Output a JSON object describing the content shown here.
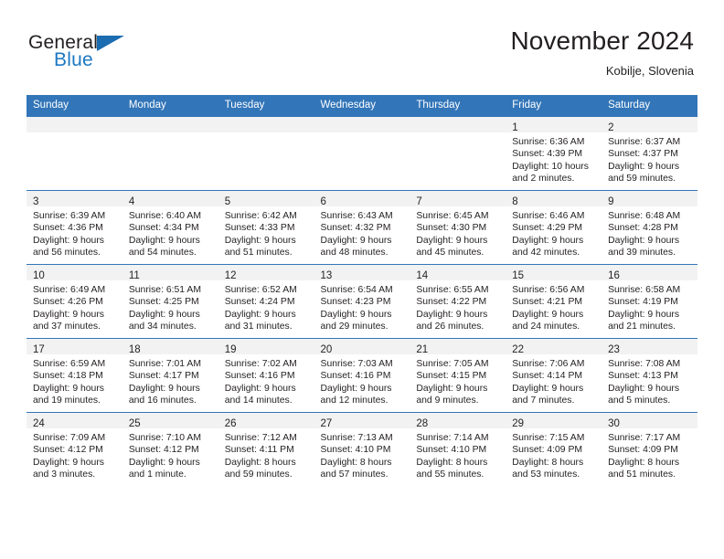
{
  "brand": {
    "name_part1": "General",
    "name_part2": "Blue",
    "flag_icon": "triangle-flag-icon"
  },
  "header": {
    "month_title": "November 2024",
    "location": "Kobilje, Slovenia"
  },
  "colors": {
    "header_blue": "#3275b8",
    "brand_blue": "#1b78c2",
    "daynum_band": "#f2f2f2",
    "text": "#231f20"
  },
  "labels": {
    "sunrise_prefix": "Sunrise:",
    "sunset_prefix": "Sunset:",
    "daylight_prefix": "Daylight:"
  },
  "weekday_headers": [
    "Sunday",
    "Monday",
    "Tuesday",
    "Wednesday",
    "Thursday",
    "Friday",
    "Saturday"
  ],
  "weeks": [
    [
      {
        "empty": true
      },
      {
        "empty": true
      },
      {
        "empty": true
      },
      {
        "empty": true
      },
      {
        "empty": true
      },
      {
        "day": "1",
        "sunrise": "Sunrise: 6:36 AM",
        "sunset": "Sunset: 4:39 PM",
        "daylight_line1": "Daylight: 10 hours",
        "daylight_line2": "and 2 minutes."
      },
      {
        "day": "2",
        "sunrise": "Sunrise: 6:37 AM",
        "sunset": "Sunset: 4:37 PM",
        "daylight_line1": "Daylight: 9 hours",
        "daylight_line2": "and 59 minutes."
      }
    ],
    [
      {
        "day": "3",
        "sunrise": "Sunrise: 6:39 AM",
        "sunset": "Sunset: 4:36 PM",
        "daylight_line1": "Daylight: 9 hours",
        "daylight_line2": "and 56 minutes."
      },
      {
        "day": "4",
        "sunrise": "Sunrise: 6:40 AM",
        "sunset": "Sunset: 4:34 PM",
        "daylight_line1": "Daylight: 9 hours",
        "daylight_line2": "and 54 minutes."
      },
      {
        "day": "5",
        "sunrise": "Sunrise: 6:42 AM",
        "sunset": "Sunset: 4:33 PM",
        "daylight_line1": "Daylight: 9 hours",
        "daylight_line2": "and 51 minutes."
      },
      {
        "day": "6",
        "sunrise": "Sunrise: 6:43 AM",
        "sunset": "Sunset: 4:32 PM",
        "daylight_line1": "Daylight: 9 hours",
        "daylight_line2": "and 48 minutes."
      },
      {
        "day": "7",
        "sunrise": "Sunrise: 6:45 AM",
        "sunset": "Sunset: 4:30 PM",
        "daylight_line1": "Daylight: 9 hours",
        "daylight_line2": "and 45 minutes."
      },
      {
        "day": "8",
        "sunrise": "Sunrise: 6:46 AM",
        "sunset": "Sunset: 4:29 PM",
        "daylight_line1": "Daylight: 9 hours",
        "daylight_line2": "and 42 minutes."
      },
      {
        "day": "9",
        "sunrise": "Sunrise: 6:48 AM",
        "sunset": "Sunset: 4:28 PM",
        "daylight_line1": "Daylight: 9 hours",
        "daylight_line2": "and 39 minutes."
      }
    ],
    [
      {
        "day": "10",
        "sunrise": "Sunrise: 6:49 AM",
        "sunset": "Sunset: 4:26 PM",
        "daylight_line1": "Daylight: 9 hours",
        "daylight_line2": "and 37 minutes."
      },
      {
        "day": "11",
        "sunrise": "Sunrise: 6:51 AM",
        "sunset": "Sunset: 4:25 PM",
        "daylight_line1": "Daylight: 9 hours",
        "daylight_line2": "and 34 minutes."
      },
      {
        "day": "12",
        "sunrise": "Sunrise: 6:52 AM",
        "sunset": "Sunset: 4:24 PM",
        "daylight_line1": "Daylight: 9 hours",
        "daylight_line2": "and 31 minutes."
      },
      {
        "day": "13",
        "sunrise": "Sunrise: 6:54 AM",
        "sunset": "Sunset: 4:23 PM",
        "daylight_line1": "Daylight: 9 hours",
        "daylight_line2": "and 29 minutes."
      },
      {
        "day": "14",
        "sunrise": "Sunrise: 6:55 AM",
        "sunset": "Sunset: 4:22 PM",
        "daylight_line1": "Daylight: 9 hours",
        "daylight_line2": "and 26 minutes."
      },
      {
        "day": "15",
        "sunrise": "Sunrise: 6:56 AM",
        "sunset": "Sunset: 4:21 PM",
        "daylight_line1": "Daylight: 9 hours",
        "daylight_line2": "and 24 minutes."
      },
      {
        "day": "16",
        "sunrise": "Sunrise: 6:58 AM",
        "sunset": "Sunset: 4:19 PM",
        "daylight_line1": "Daylight: 9 hours",
        "daylight_line2": "and 21 minutes."
      }
    ],
    [
      {
        "day": "17",
        "sunrise": "Sunrise: 6:59 AM",
        "sunset": "Sunset: 4:18 PM",
        "daylight_line1": "Daylight: 9 hours",
        "daylight_line2": "and 19 minutes."
      },
      {
        "day": "18",
        "sunrise": "Sunrise: 7:01 AM",
        "sunset": "Sunset: 4:17 PM",
        "daylight_line1": "Daylight: 9 hours",
        "daylight_line2": "and 16 minutes."
      },
      {
        "day": "19",
        "sunrise": "Sunrise: 7:02 AM",
        "sunset": "Sunset: 4:16 PM",
        "daylight_line1": "Daylight: 9 hours",
        "daylight_line2": "and 14 minutes."
      },
      {
        "day": "20",
        "sunrise": "Sunrise: 7:03 AM",
        "sunset": "Sunset: 4:16 PM",
        "daylight_line1": "Daylight: 9 hours",
        "daylight_line2": "and 12 minutes."
      },
      {
        "day": "21",
        "sunrise": "Sunrise: 7:05 AM",
        "sunset": "Sunset: 4:15 PM",
        "daylight_line1": "Daylight: 9 hours",
        "daylight_line2": "and 9 minutes."
      },
      {
        "day": "22",
        "sunrise": "Sunrise: 7:06 AM",
        "sunset": "Sunset: 4:14 PM",
        "daylight_line1": "Daylight: 9 hours",
        "daylight_line2": "and 7 minutes."
      },
      {
        "day": "23",
        "sunrise": "Sunrise: 7:08 AM",
        "sunset": "Sunset: 4:13 PM",
        "daylight_line1": "Daylight: 9 hours",
        "daylight_line2": "and 5 minutes."
      }
    ],
    [
      {
        "day": "24",
        "sunrise": "Sunrise: 7:09 AM",
        "sunset": "Sunset: 4:12 PM",
        "daylight_line1": "Daylight: 9 hours",
        "daylight_line2": "and 3 minutes."
      },
      {
        "day": "25",
        "sunrise": "Sunrise: 7:10 AM",
        "sunset": "Sunset: 4:12 PM",
        "daylight_line1": "Daylight: 9 hours",
        "daylight_line2": "and 1 minute."
      },
      {
        "day": "26",
        "sunrise": "Sunrise: 7:12 AM",
        "sunset": "Sunset: 4:11 PM",
        "daylight_line1": "Daylight: 8 hours",
        "daylight_line2": "and 59 minutes."
      },
      {
        "day": "27",
        "sunrise": "Sunrise: 7:13 AM",
        "sunset": "Sunset: 4:10 PM",
        "daylight_line1": "Daylight: 8 hours",
        "daylight_line2": "and 57 minutes."
      },
      {
        "day": "28",
        "sunrise": "Sunrise: 7:14 AM",
        "sunset": "Sunset: 4:10 PM",
        "daylight_line1": "Daylight: 8 hours",
        "daylight_line2": "and 55 minutes."
      },
      {
        "day": "29",
        "sunrise": "Sunrise: 7:15 AM",
        "sunset": "Sunset: 4:09 PM",
        "daylight_line1": "Daylight: 8 hours",
        "daylight_line2": "and 53 minutes."
      },
      {
        "day": "30",
        "sunrise": "Sunrise: 7:17 AM",
        "sunset": "Sunset: 4:09 PM",
        "daylight_line1": "Daylight: 8 hours",
        "daylight_line2": "and 51 minutes."
      }
    ]
  ]
}
